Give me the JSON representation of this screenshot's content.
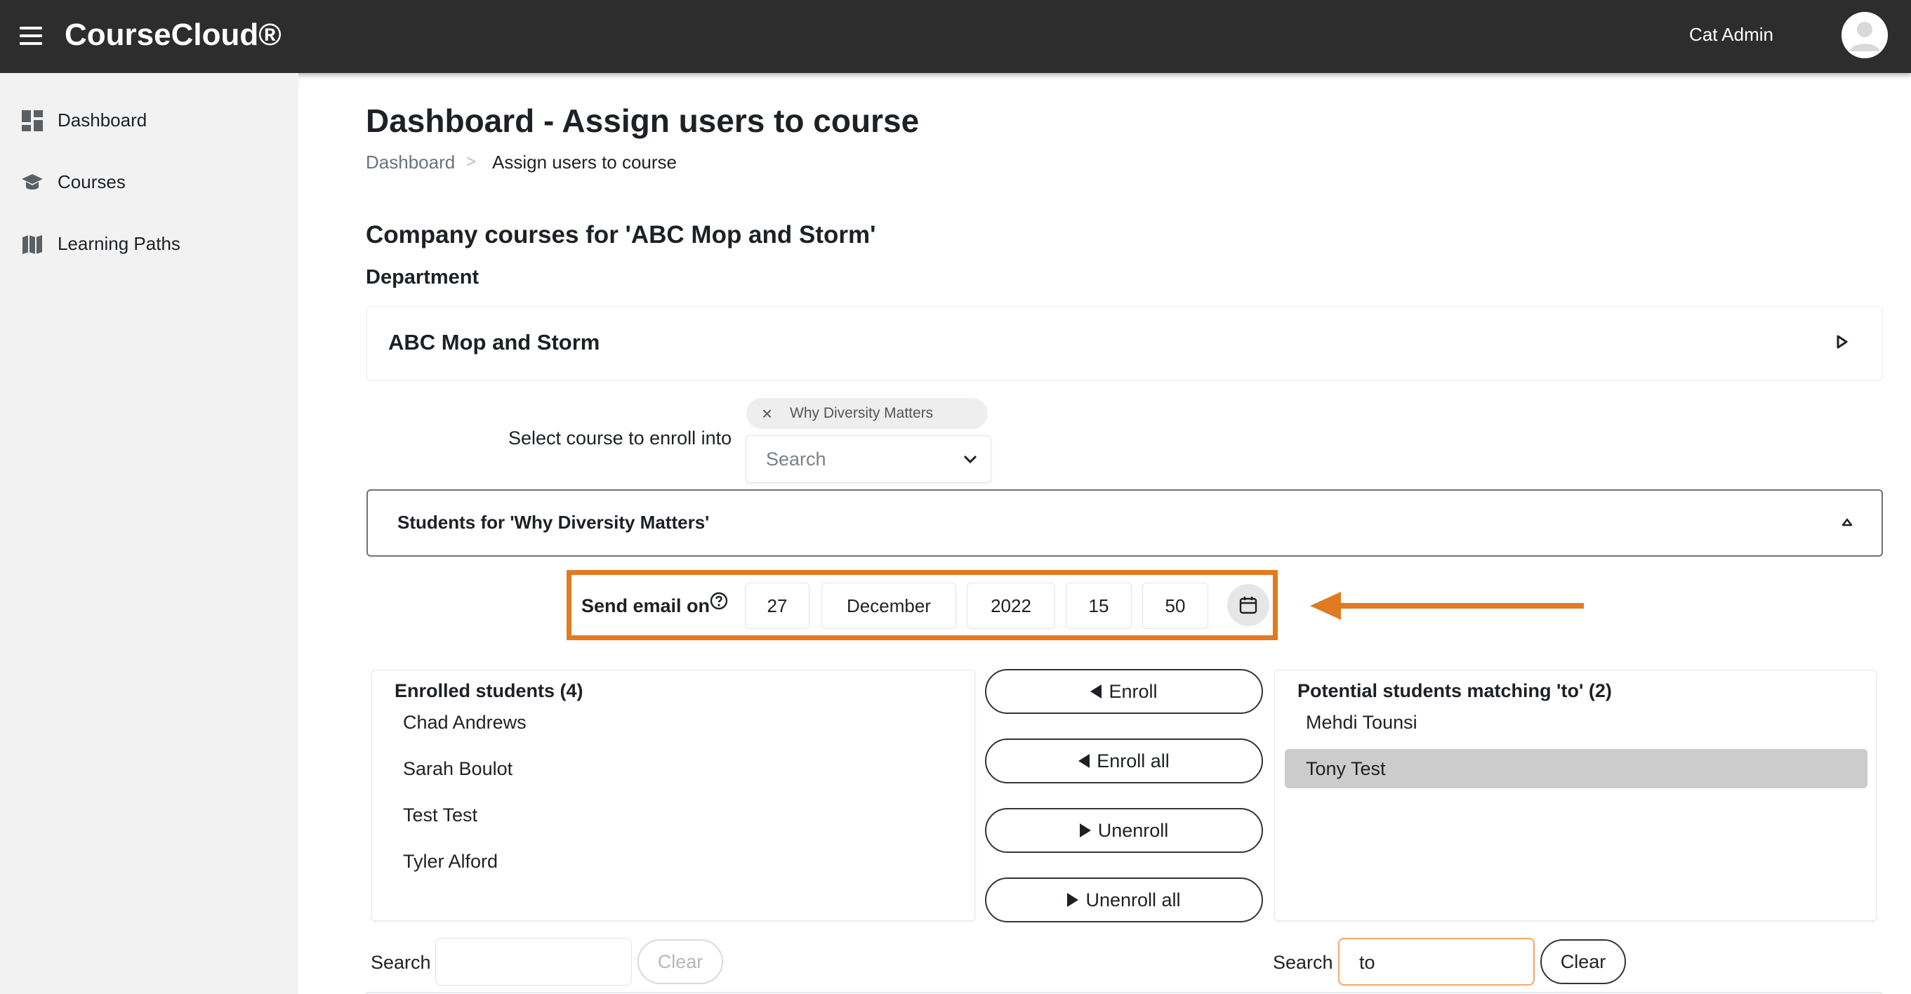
{
  "header": {
    "brand": "CourseCloud®",
    "user_name": "Cat Admin"
  },
  "sidebar": {
    "items": [
      {
        "label": "Dashboard",
        "icon": "dashboard-icon"
      },
      {
        "label": "Courses",
        "icon": "graduation-cap-icon"
      },
      {
        "label": "Learning Paths",
        "icon": "map-icon"
      }
    ]
  },
  "page": {
    "title": "Dashboard - Assign users to course",
    "breadcrumb": {
      "root": "Dashboard",
      "separator": ">",
      "current": "Assign users to course"
    },
    "section_heading": "Company courses for 'ABC Mop and Storm'",
    "department_label": "Department",
    "department_name": "ABC Mop and Storm"
  },
  "course_select": {
    "label": "Select course to enroll into",
    "selected_chip": "Why Diversity Matters",
    "chip_remove": "×",
    "placeholder": "Search"
  },
  "students_panel": {
    "title": "Students for 'Why Diversity Matters'"
  },
  "send_email": {
    "label": "Send email on",
    "day": "27",
    "month": "December",
    "year": "2022",
    "hour": "15",
    "minute": "50"
  },
  "enrolled": {
    "title": "Enrolled students (4)",
    "students": [
      "Chad Andrews",
      "Sarah Boulot",
      "Test Test",
      "Tyler Alford"
    ]
  },
  "actions": {
    "enroll": "Enroll",
    "enroll_all": "Enroll all",
    "unenroll": "Unenroll",
    "unenroll_all": "Unenroll all"
  },
  "potential": {
    "title": "Potential students matching 'to' (2)",
    "students": [
      "Mehdi Tounsi",
      "Tony Test"
    ],
    "selected": "Tony Test"
  },
  "enrolled_search": {
    "label": "Search",
    "value": "",
    "clear": "Clear"
  },
  "potential_search": {
    "label": "Search",
    "value": "to",
    "clear": "Clear"
  },
  "colors": {
    "topbar": "#2d2d2d",
    "sidebar": "#f2f2f2",
    "highlight": "#e07b21",
    "selected_row": "#cccccc"
  }
}
